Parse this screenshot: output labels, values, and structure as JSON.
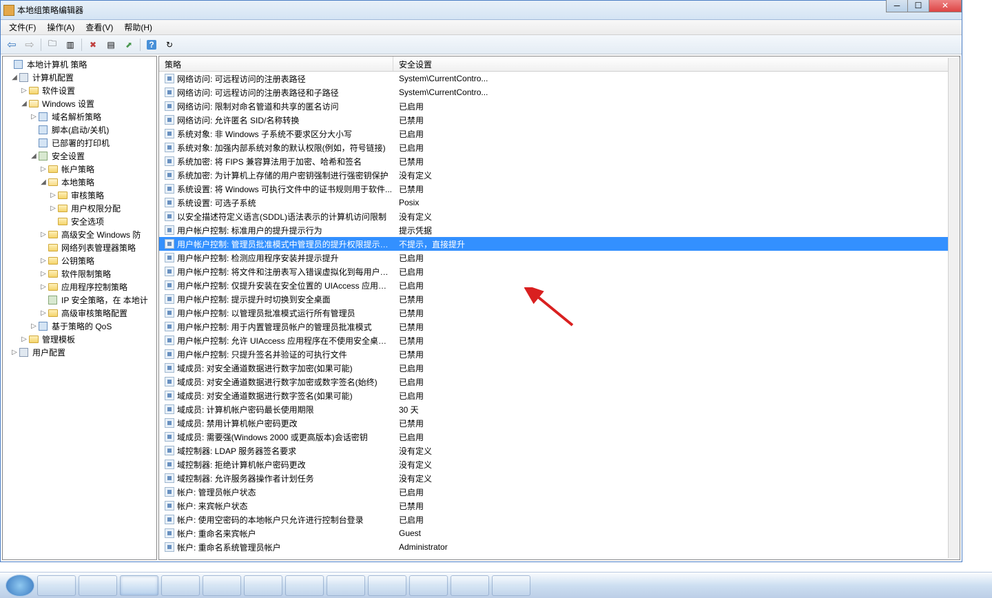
{
  "window": {
    "title": "本地组策略编辑器"
  },
  "menu": {
    "file": "文件(F)",
    "action": "操作(A)",
    "view": "查看(V)",
    "help": "帮助(H)"
  },
  "tree": {
    "root": "本地计算机 策略",
    "comp_config": "计算机配置",
    "software_settings": "软件设置",
    "windows_settings": "Windows 设置",
    "name_resolution": "域名解析策略",
    "scripts": "脚本(启动/关机)",
    "deployed_printers": "已部署的打印机",
    "security_settings": "安全设置",
    "account_policies": "帐户策略",
    "local_policies": "本地策略",
    "audit_policy": "审核策略",
    "user_rights": "用户权限分配",
    "security_options": "安全选项",
    "advanced_firewall": "高级安全 Windows 防",
    "network_list": "网络列表管理器策略",
    "public_key": "公钥策略",
    "software_restriction": "软件限制策略",
    "app_control": "应用程序控制策略",
    "ip_security": "IP 安全策略，在 本地计",
    "advanced_audit": "高级审核策略配置",
    "qos": "基于策略的 QoS",
    "admin_templates": "管理模板",
    "user_config": "用户配置"
  },
  "columns": {
    "policy": "策略",
    "setting": "安全设置"
  },
  "rows": [
    {
      "p": "网络访问: 可远程访问的注册表路径",
      "s": "System\\CurrentContro..."
    },
    {
      "p": "网络访问: 可远程访问的注册表路径和子路径",
      "s": "System\\CurrentContro..."
    },
    {
      "p": "网络访问: 限制对命名管道和共享的匿名访问",
      "s": "已启用"
    },
    {
      "p": "网络访问: 允许匿名 SID/名称转换",
      "s": "已禁用"
    },
    {
      "p": "系统对象: 非 Windows 子系统不要求区分大小写",
      "s": "已启用"
    },
    {
      "p": "系统对象: 加强内部系统对象的默认权限(例如，符号链接)",
      "s": "已启用"
    },
    {
      "p": "系统加密: 将 FIPS 兼容算法用于加密、哈希和签名",
      "s": "已禁用"
    },
    {
      "p": "系统加密: 为计算机上存储的用户密钥强制进行强密钥保护",
      "s": "没有定义"
    },
    {
      "p": "系统设置: 将 Windows 可执行文件中的证书规则用于软件...",
      "s": "已禁用"
    },
    {
      "p": "系统设置: 可选子系统",
      "s": "Posix"
    },
    {
      "p": "以安全描述符定义语言(SDDL)语法表示的计算机访问限制",
      "s": "没有定义"
    },
    {
      "p": "用户帐户控制: 标准用户的提升提示行为",
      "s": "提示凭据"
    },
    {
      "p": "用户帐户控制: 管理员批准模式中管理员的提升权限提示的...",
      "s": "不提示，直接提升",
      "sel": true
    },
    {
      "p": "用户帐户控制: 检测应用程序安装并提示提升",
      "s": "已启用"
    },
    {
      "p": "用户帐户控制: 将文件和注册表写入错误虚拟化到每用户位置",
      "s": "已启用"
    },
    {
      "p": "用户帐户控制: 仅提升安装在安全位置的 UIAccess 应用程序",
      "s": "已启用"
    },
    {
      "p": "用户帐户控制: 提示提升时切换到安全桌面",
      "s": "已禁用"
    },
    {
      "p": "用户帐户控制: 以管理员批准模式运行所有管理员",
      "s": "已禁用"
    },
    {
      "p": "用户帐户控制: 用于内置管理员帐户的管理员批准模式",
      "s": "已禁用"
    },
    {
      "p": "用户帐户控制: 允许 UIAccess 应用程序在不使用安全桌面...",
      "s": "已禁用"
    },
    {
      "p": "用户帐户控制: 只提升签名并验证的可执行文件",
      "s": "已禁用"
    },
    {
      "p": "域成员: 对安全通道数据进行数字加密(如果可能)",
      "s": "已启用"
    },
    {
      "p": "域成员: 对安全通道数据进行数字加密或数字签名(始终)",
      "s": "已启用"
    },
    {
      "p": "域成员: 对安全通道数据进行数字签名(如果可能)",
      "s": "已启用"
    },
    {
      "p": "域成员: 计算机帐户密码最长使用期限",
      "s": "30 天"
    },
    {
      "p": "域成员: 禁用计算机帐户密码更改",
      "s": "已禁用"
    },
    {
      "p": "域成员: 需要强(Windows 2000 或更高版本)会话密钥",
      "s": "已启用"
    },
    {
      "p": "域控制器: LDAP 服务器签名要求",
      "s": "没有定义"
    },
    {
      "p": "域控制器: 拒绝计算机帐户密码更改",
      "s": "没有定义"
    },
    {
      "p": "域控制器: 允许服务器操作者计划任务",
      "s": "没有定义"
    },
    {
      "p": "帐户: 管理员帐户状态",
      "s": "已启用"
    },
    {
      "p": "帐户: 来宾帐户状态",
      "s": "已禁用"
    },
    {
      "p": "帐户: 使用空密码的本地帐户只允许进行控制台登录",
      "s": "已启用"
    },
    {
      "p": "帐户: 重命名来宾帐户",
      "s": "Guest"
    },
    {
      "p": "帐户: 重命名系统管理员帐户",
      "s": "Administrator"
    }
  ]
}
